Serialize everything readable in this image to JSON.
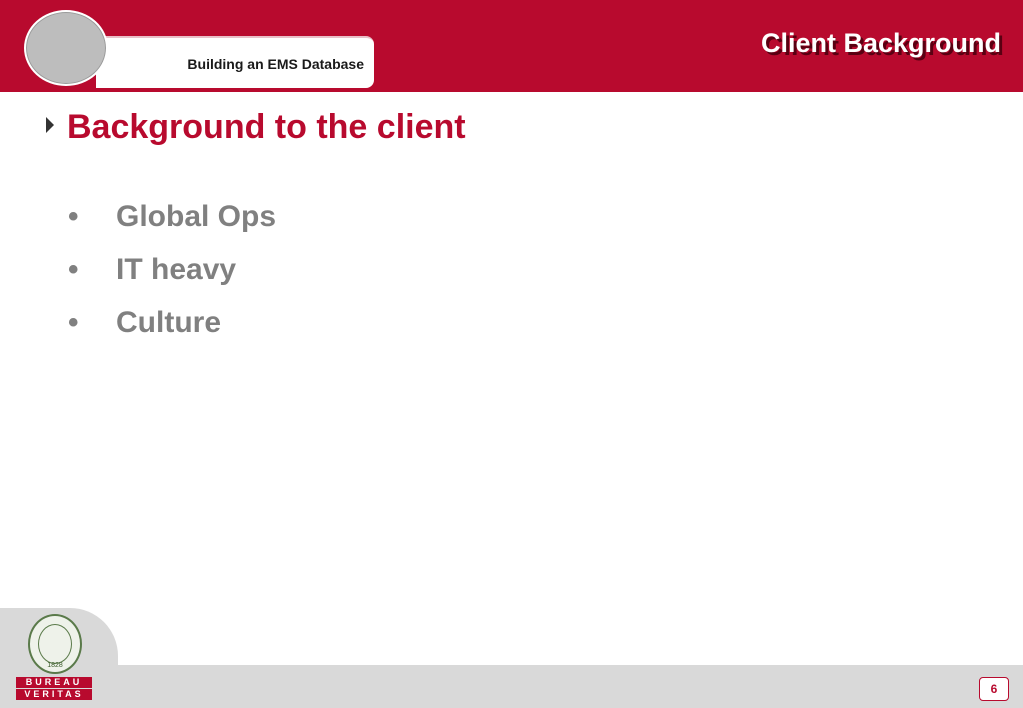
{
  "header": {
    "title": "Client Background",
    "subtitle": "Building an EMS Database"
  },
  "content": {
    "main_bullet": "Background to the client",
    "sub_bullets": [
      "Global Ops",
      "IT heavy",
      "Culture"
    ],
    "sub_bullet_symbol": "•"
  },
  "footer": {
    "logo_line1": "BUREAU",
    "logo_line2": "VERITAS",
    "logo_year": "1828",
    "page_number": "6"
  },
  "colors": {
    "brand_red": "#b80a2e",
    "sub_text_gray": "#808080",
    "footer_gray": "#d9d9d9"
  }
}
